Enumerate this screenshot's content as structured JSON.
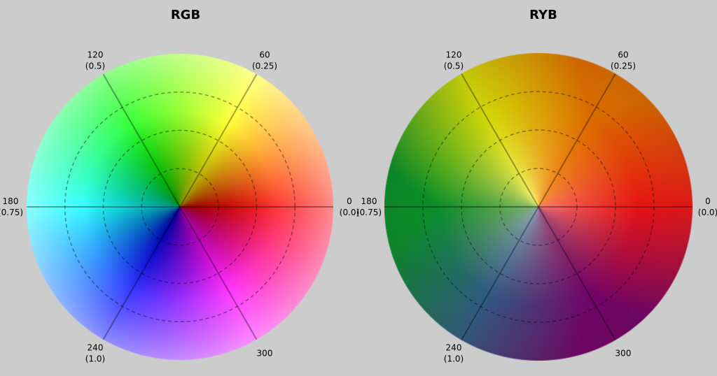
{
  "panels": [
    {
      "id": "rgb",
      "title": "RGB",
      "model": "rgb",
      "angle_labels": [
        {
          "deg": 0,
          "lines": [
            "0",
            "(0.0)"
          ]
        },
        {
          "deg": 60,
          "lines": [
            "60",
            "(0.25)"
          ]
        },
        {
          "deg": 120,
          "lines": [
            "120",
            "(0.5)"
          ]
        },
        {
          "deg": 180,
          "lines": [
            "180",
            "(0.75)"
          ]
        },
        {
          "deg": 240,
          "lines": [
            "240",
            "(1.0)"
          ]
        },
        {
          "deg": 300,
          "lines": [
            "300"
          ]
        }
      ]
    },
    {
      "id": "ryb",
      "title": "RYB",
      "model": "ryb",
      "angle_labels": [
        {
          "deg": 0,
          "lines": [
            "0",
            "(0.0)"
          ]
        },
        {
          "deg": 60,
          "lines": [
            "60",
            "(0.25)"
          ]
        },
        {
          "deg": 120,
          "lines": [
            "120",
            "(0.5)"
          ]
        },
        {
          "deg": 180,
          "lines": [
            "180",
            "(0.75)"
          ]
        },
        {
          "deg": 240,
          "lines": [
            "240",
            "(1.0)"
          ]
        },
        {
          "deg": 300,
          "lines": [
            "300"
          ]
        }
      ]
    }
  ],
  "wheel": {
    "spoke_angles": [
      0,
      60,
      120,
      180,
      240,
      300
    ],
    "ring_fractions": [
      0.25,
      0.5,
      0.75
    ]
  },
  "colors": {
    "background": "#cccccc",
    "spoke": "rgba(0,0,0,0.35)",
    "ring": "rgba(0,0,0,0.4)"
  }
}
